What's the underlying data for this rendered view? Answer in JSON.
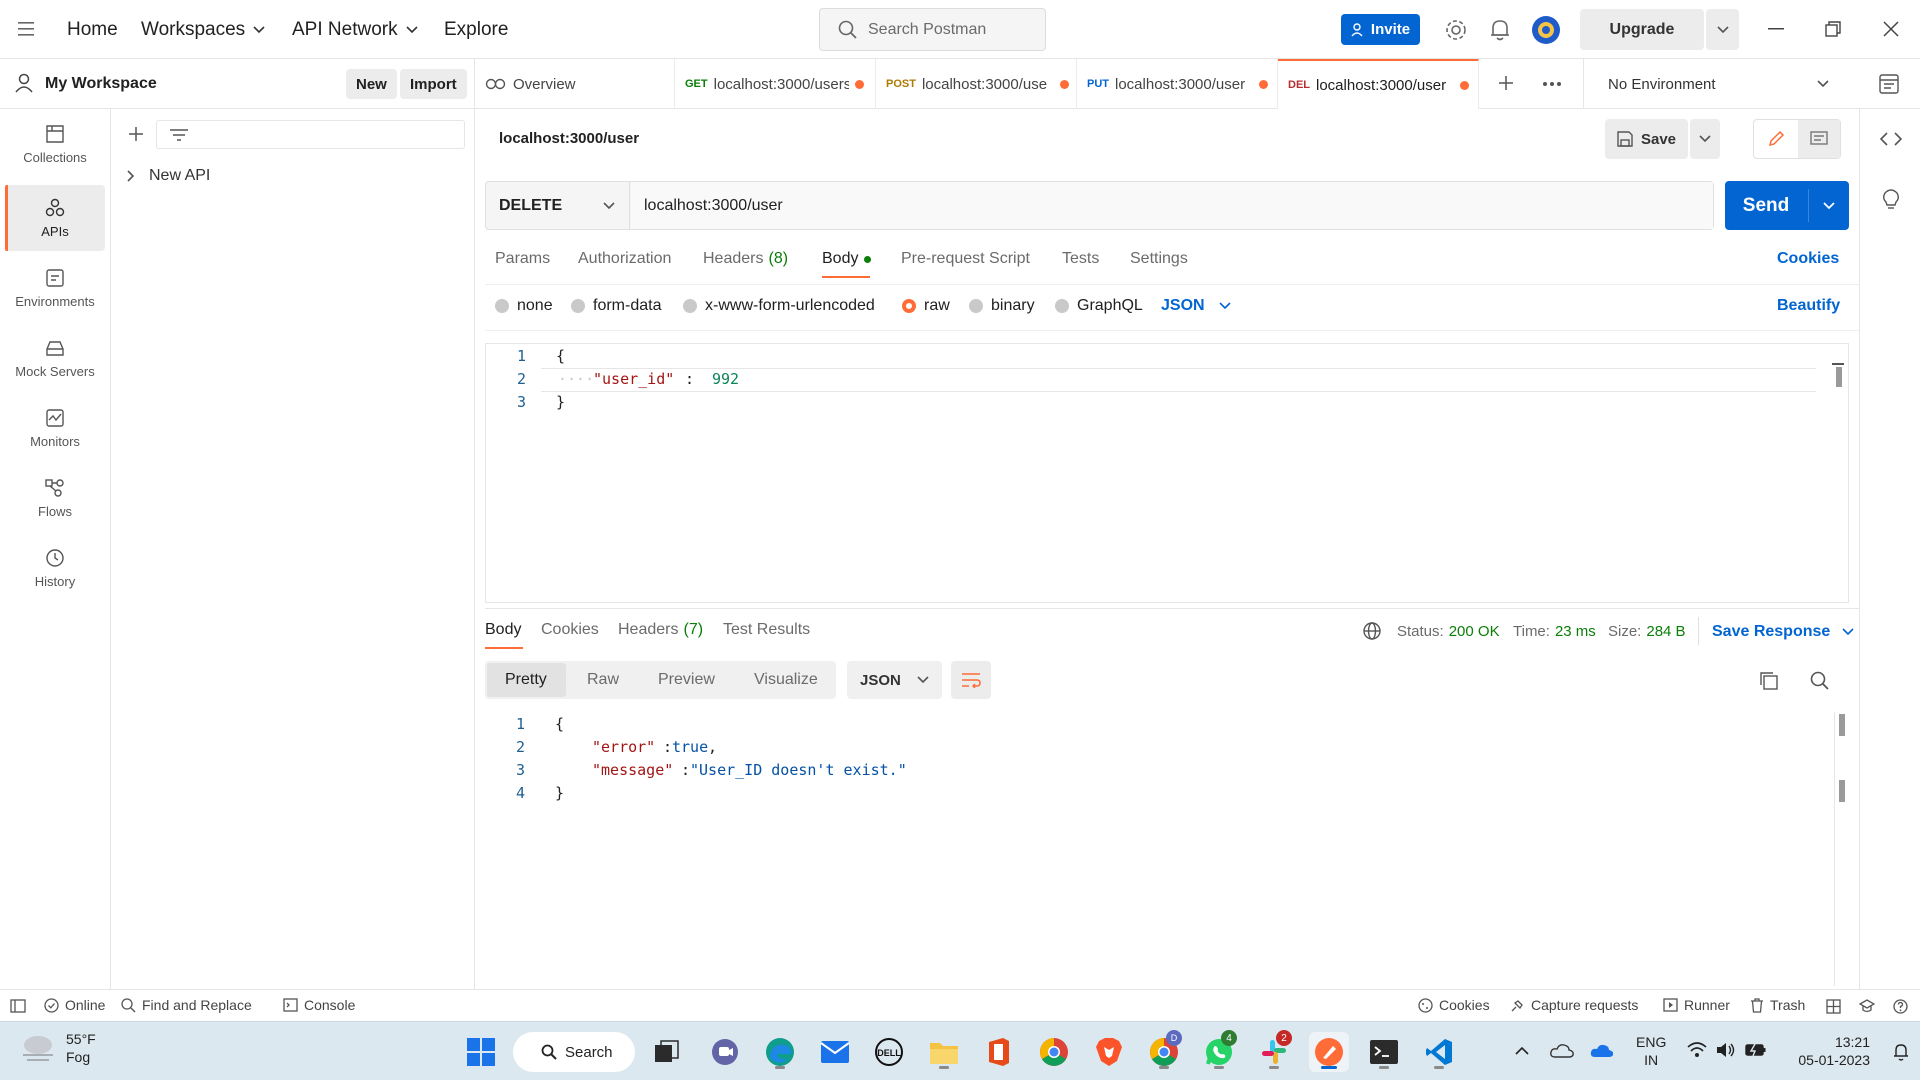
{
  "header": {
    "nav": [
      "Home",
      "Workspaces",
      "API Network",
      "Explore"
    ],
    "search_placeholder": "Search Postman",
    "invite_label": "Invite",
    "upgrade_label": "Upgrade"
  },
  "workspace": {
    "name": "My Workspace",
    "new_label": "New",
    "import_label": "Import"
  },
  "sidebar": {
    "items": [
      {
        "label": "Collections",
        "icon": "collections-icon"
      },
      {
        "label": "APIs",
        "icon": "apis-icon",
        "active": true
      },
      {
        "label": "Environments",
        "icon": "environments-icon"
      },
      {
        "label": "Mock Servers",
        "icon": "mock-servers-icon"
      },
      {
        "label": "Monitors",
        "icon": "monitors-icon"
      },
      {
        "label": "Flows",
        "icon": "flows-icon"
      },
      {
        "label": "History",
        "icon": "history-icon"
      }
    ],
    "tree": [
      {
        "label": "New API"
      }
    ]
  },
  "tabs": [
    {
      "label": "Overview"
    },
    {
      "method": "GET",
      "label": "localhost:3000/users",
      "method_color": "#0a7e07"
    },
    {
      "method": "POST",
      "label": "localhost:3000/use",
      "method_color": "#ad7a03"
    },
    {
      "method": "PUT",
      "label": "localhost:3000/user",
      "method_color": "#0265d2"
    },
    {
      "method": "DEL",
      "label": "localhost:3000/user",
      "method_color": "#b72e2e",
      "active": true
    }
  ],
  "environment": {
    "selected": "No Environment"
  },
  "request": {
    "title": "localhost:3000/user",
    "save_label": "Save",
    "method": "DELETE",
    "url": "localhost:3000/user",
    "send_label": "Send",
    "tabs": [
      "Params",
      "Authorization",
      "Headers",
      "Body",
      "Pre-request Script",
      "Tests",
      "Settings"
    ],
    "headers_count": "(8)",
    "cookies_label": "Cookies",
    "body_modes": [
      "none",
      "form-data",
      "x-www-form-urlencoded",
      "raw",
      "binary",
      "GraphQL"
    ],
    "body_format": "JSON",
    "beautify_label": "Beautify",
    "body_lines": [
      "1",
      "2",
      "3"
    ],
    "body_key": "\"user_id\"",
    "body_colon": " : ",
    "body_value": "992",
    "brace_open": "{",
    "brace_close": "}"
  },
  "response": {
    "tabs": [
      "Body",
      "Cookies",
      "Headers",
      "Test Results"
    ],
    "headers_count": "(7)",
    "status_label": "Status:",
    "status_value": "200 OK",
    "time_label": "Time:",
    "time_value": "23 ms",
    "size_label": "Size:",
    "size_value": "284 B",
    "save_response_label": "Save Response",
    "views": [
      "Pretty",
      "Raw",
      "Preview",
      "Visualize"
    ],
    "format": "JSON",
    "lines": [
      "1",
      "2",
      "3",
      "4"
    ],
    "error_key": "\"error\"",
    "error_value": "true",
    "message_key": "\"message\"",
    "message_value": "\"User_ID doesn't exist.\"",
    "brace_open": "{",
    "brace_close": "}"
  },
  "statusbar": {
    "online": "Online",
    "find_replace": "Find and Replace",
    "console": "Console",
    "cookies": "Cookies",
    "capture": "Capture requests",
    "runner": "Runner",
    "trash": "Trash"
  },
  "taskbar": {
    "weather_temp": "55°F",
    "weather_desc": "Fog",
    "search_label": "Search",
    "lang_top": "ENG",
    "lang_bottom": "IN",
    "time": "13:21",
    "date": "05-01-2023",
    "badge_discord": "D",
    "badge_whatsapp": "4",
    "badge_slack": "2"
  },
  "colors": {
    "accent": "#ff6c37",
    "primary": "#0265d2",
    "status_ok": "#0a7e07"
  }
}
